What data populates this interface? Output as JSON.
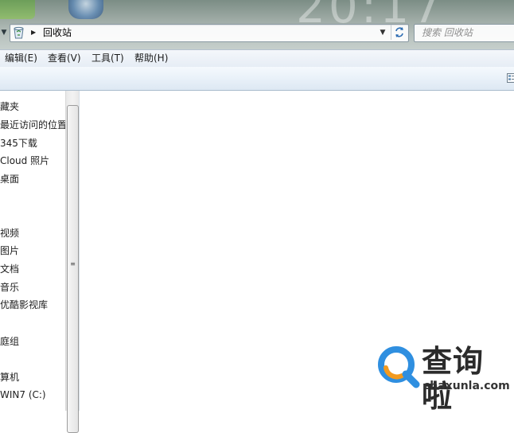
{
  "window": {
    "desktop_clock": "20:17"
  },
  "address_bar": {
    "location": "回收站",
    "separator": "▶",
    "location_icon": "recycle-bin-icon",
    "history_icon": "chevron-down-icon",
    "refresh_icon": "refresh-icon"
  },
  "search": {
    "placeholder": "搜索 回收站"
  },
  "menu": {
    "items": [
      {
        "label": "编辑(E)"
      },
      {
        "label": "查看(V)"
      },
      {
        "label": "工具(T)"
      },
      {
        "label": "帮助(H)"
      }
    ]
  },
  "nav_pane": {
    "items": [
      {
        "label": "藏夹"
      },
      {
        "label": "最近访问的位置"
      },
      {
        "label": "345下载"
      },
      {
        "label": "Cloud 照片"
      },
      {
        "label": "桌面"
      },
      {
        "label": "视频"
      },
      {
        "label": "图片"
      },
      {
        "label": "文档"
      },
      {
        "label": "音乐"
      },
      {
        "label": "优酷影视库"
      },
      {
        "label": "庭组"
      },
      {
        "label": "算机"
      },
      {
        "label": "WIN7 (C:)"
      }
    ]
  },
  "watermark": {
    "title": "查询啦",
    "url": "chaxunla.com"
  },
  "colors": {
    "accent_blue": "#2f8fe0",
    "accent_orange": "#f39a1e"
  }
}
